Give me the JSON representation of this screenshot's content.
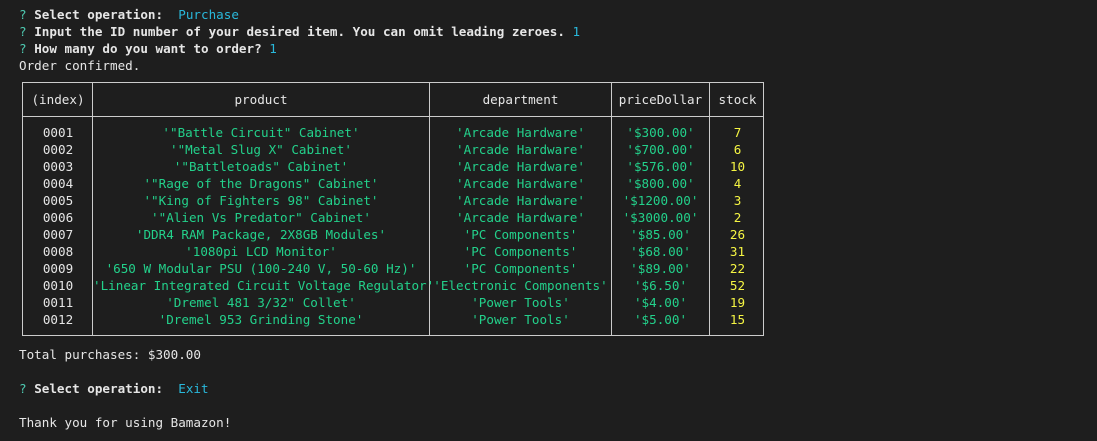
{
  "prompts": [
    {
      "marker": "?",
      "question": "Select operation:",
      "answer": "Purchase"
    },
    {
      "marker": "?",
      "question": "Input the ID number of your desired item. You can omit leading zeroes.",
      "answer": "1"
    },
    {
      "marker": "?",
      "question": "How many do you want to order?",
      "answer": "1"
    }
  ],
  "order_message": "Order confirmed.",
  "table": {
    "headers": [
      "(index)",
      "product",
      "department",
      "priceDollar",
      "stock"
    ],
    "rows": [
      {
        "index": "0001",
        "product": "'\"Battle Circuit\" Cabinet'",
        "department": "'Arcade Hardware'",
        "price": "'$300.00'",
        "stock": "7"
      },
      {
        "index": "0002",
        "product": "'\"Metal Slug X\" Cabinet'",
        "department": "'Arcade Hardware'",
        "price": "'$700.00'",
        "stock": "6"
      },
      {
        "index": "0003",
        "product": "'\"Battletoads\" Cabinet'",
        "department": "'Arcade Hardware'",
        "price": "'$576.00'",
        "stock": "10"
      },
      {
        "index": "0004",
        "product": "'\"Rage of the Dragons\" Cabinet'",
        "department": "'Arcade Hardware'",
        "price": "'$800.00'",
        "stock": "4"
      },
      {
        "index": "0005",
        "product": "'\"King of Fighters 98\" Cabinet'",
        "department": "'Arcade Hardware'",
        "price": "'$1200.00'",
        "stock": "3"
      },
      {
        "index": "0006",
        "product": "'\"Alien Vs Predator\" Cabinet'",
        "department": "'Arcade Hardware'",
        "price": "'$3000.00'",
        "stock": "2"
      },
      {
        "index": "0007",
        "product": "'DDR4 RAM Package, 2X8GB Modules'",
        "department": "'PC Components'",
        "price": "'$85.00'",
        "stock": "26"
      },
      {
        "index": "0008",
        "product": "'1080pi LCD Monitor'",
        "department": "'PC Components'",
        "price": "'$68.00'",
        "stock": "31"
      },
      {
        "index": "0009",
        "product": "'650 W Modular PSU (100-240 V, 50-60 Hz)'",
        "department": "'PC Components'",
        "price": "'$89.00'",
        "stock": "22"
      },
      {
        "index": "0010",
        "product": "'Linear Integrated Circuit Voltage Regulator'",
        "department": "'Electronic Components'",
        "price": "'$6.50'",
        "stock": "52"
      },
      {
        "index": "0011",
        "product": "'Dremel 481 3/32\" Collet'",
        "department": "'Power Tools'",
        "price": "'$4.00'",
        "stock": "19"
      },
      {
        "index": "0012",
        "product": "'Dremel 953 Grinding Stone'",
        "department": "'Power Tools'",
        "price": "'$5.00'",
        "stock": "15"
      }
    ]
  },
  "total_purchases": "Total purchases: $300.00",
  "prompt_exit": {
    "marker": "?",
    "question": "Select operation:",
    "answer": "Exit"
  },
  "farewell": "Thank you for using Bamazon!",
  "colors": {
    "background": "#1e1e1e",
    "prompt_marker": "#4ec9b0",
    "answer": "#29b8db",
    "string_value": "#23d18b",
    "number_value": "#f5f543"
  }
}
